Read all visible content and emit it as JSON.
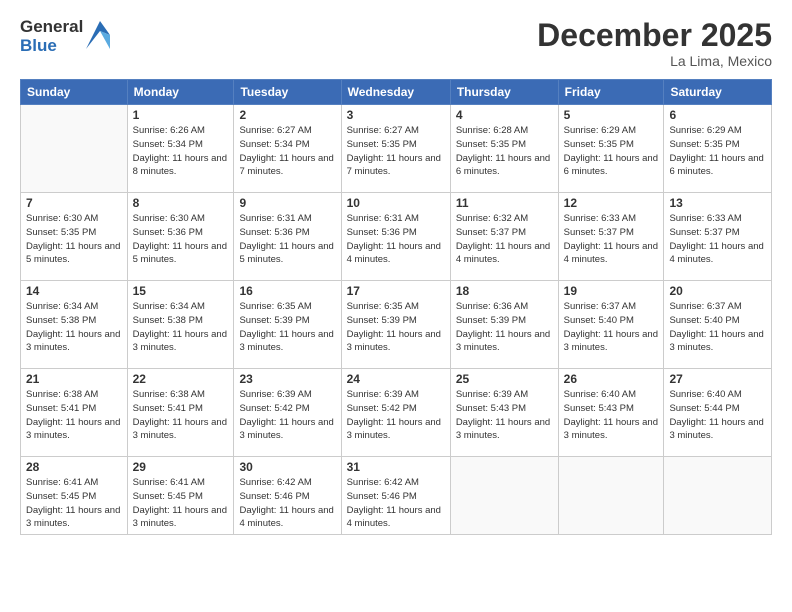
{
  "logo": {
    "general": "General",
    "blue": "Blue"
  },
  "title": "December 2025",
  "location": "La Lima, Mexico",
  "weekdays": [
    "Sunday",
    "Monday",
    "Tuesday",
    "Wednesday",
    "Thursday",
    "Friday",
    "Saturday"
  ],
  "weeks": [
    [
      {
        "day": "",
        "info": ""
      },
      {
        "day": "1",
        "info": "Sunrise: 6:26 AM\nSunset: 5:34 PM\nDaylight: 11 hours\nand 8 minutes."
      },
      {
        "day": "2",
        "info": "Sunrise: 6:27 AM\nSunset: 5:34 PM\nDaylight: 11 hours\nand 7 minutes."
      },
      {
        "day": "3",
        "info": "Sunrise: 6:27 AM\nSunset: 5:35 PM\nDaylight: 11 hours\nand 7 minutes."
      },
      {
        "day": "4",
        "info": "Sunrise: 6:28 AM\nSunset: 5:35 PM\nDaylight: 11 hours\nand 6 minutes."
      },
      {
        "day": "5",
        "info": "Sunrise: 6:29 AM\nSunset: 5:35 PM\nDaylight: 11 hours\nand 6 minutes."
      },
      {
        "day": "6",
        "info": "Sunrise: 6:29 AM\nSunset: 5:35 PM\nDaylight: 11 hours\nand 6 minutes."
      }
    ],
    [
      {
        "day": "7",
        "info": "Sunrise: 6:30 AM\nSunset: 5:35 PM\nDaylight: 11 hours\nand 5 minutes."
      },
      {
        "day": "8",
        "info": "Sunrise: 6:30 AM\nSunset: 5:36 PM\nDaylight: 11 hours\nand 5 minutes."
      },
      {
        "day": "9",
        "info": "Sunrise: 6:31 AM\nSunset: 5:36 PM\nDaylight: 11 hours\nand 5 minutes."
      },
      {
        "day": "10",
        "info": "Sunrise: 6:31 AM\nSunset: 5:36 PM\nDaylight: 11 hours\nand 4 minutes."
      },
      {
        "day": "11",
        "info": "Sunrise: 6:32 AM\nSunset: 5:37 PM\nDaylight: 11 hours\nand 4 minutes."
      },
      {
        "day": "12",
        "info": "Sunrise: 6:33 AM\nSunset: 5:37 PM\nDaylight: 11 hours\nand 4 minutes."
      },
      {
        "day": "13",
        "info": "Sunrise: 6:33 AM\nSunset: 5:37 PM\nDaylight: 11 hours\nand 4 minutes."
      }
    ],
    [
      {
        "day": "14",
        "info": "Sunrise: 6:34 AM\nSunset: 5:38 PM\nDaylight: 11 hours\nand 3 minutes."
      },
      {
        "day": "15",
        "info": "Sunrise: 6:34 AM\nSunset: 5:38 PM\nDaylight: 11 hours\nand 3 minutes."
      },
      {
        "day": "16",
        "info": "Sunrise: 6:35 AM\nSunset: 5:39 PM\nDaylight: 11 hours\nand 3 minutes."
      },
      {
        "day": "17",
        "info": "Sunrise: 6:35 AM\nSunset: 5:39 PM\nDaylight: 11 hours\nand 3 minutes."
      },
      {
        "day": "18",
        "info": "Sunrise: 6:36 AM\nSunset: 5:39 PM\nDaylight: 11 hours\nand 3 minutes."
      },
      {
        "day": "19",
        "info": "Sunrise: 6:37 AM\nSunset: 5:40 PM\nDaylight: 11 hours\nand 3 minutes."
      },
      {
        "day": "20",
        "info": "Sunrise: 6:37 AM\nSunset: 5:40 PM\nDaylight: 11 hours\nand 3 minutes."
      }
    ],
    [
      {
        "day": "21",
        "info": "Sunrise: 6:38 AM\nSunset: 5:41 PM\nDaylight: 11 hours\nand 3 minutes."
      },
      {
        "day": "22",
        "info": "Sunrise: 6:38 AM\nSunset: 5:41 PM\nDaylight: 11 hours\nand 3 minutes."
      },
      {
        "day": "23",
        "info": "Sunrise: 6:39 AM\nSunset: 5:42 PM\nDaylight: 11 hours\nand 3 minutes."
      },
      {
        "day": "24",
        "info": "Sunrise: 6:39 AM\nSunset: 5:42 PM\nDaylight: 11 hours\nand 3 minutes."
      },
      {
        "day": "25",
        "info": "Sunrise: 6:39 AM\nSunset: 5:43 PM\nDaylight: 11 hours\nand 3 minutes."
      },
      {
        "day": "26",
        "info": "Sunrise: 6:40 AM\nSunset: 5:43 PM\nDaylight: 11 hours\nand 3 minutes."
      },
      {
        "day": "27",
        "info": "Sunrise: 6:40 AM\nSunset: 5:44 PM\nDaylight: 11 hours\nand 3 minutes."
      }
    ],
    [
      {
        "day": "28",
        "info": "Sunrise: 6:41 AM\nSunset: 5:45 PM\nDaylight: 11 hours\nand 3 minutes."
      },
      {
        "day": "29",
        "info": "Sunrise: 6:41 AM\nSunset: 5:45 PM\nDaylight: 11 hours\nand 3 minutes."
      },
      {
        "day": "30",
        "info": "Sunrise: 6:42 AM\nSunset: 5:46 PM\nDaylight: 11 hours\nand 4 minutes."
      },
      {
        "day": "31",
        "info": "Sunrise: 6:42 AM\nSunset: 5:46 PM\nDaylight: 11 hours\nand 4 minutes."
      },
      {
        "day": "",
        "info": ""
      },
      {
        "day": "",
        "info": ""
      },
      {
        "day": "",
        "info": ""
      }
    ]
  ]
}
